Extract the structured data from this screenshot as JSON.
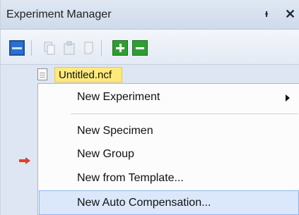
{
  "panel": {
    "title": "Experiment Manager",
    "pin_glyph": "ᵻ",
    "close_glyph": "✕"
  },
  "toolbar": {
    "icons": [
      "layout-icon",
      "copy-icon",
      "paste-icon",
      "delete-icon",
      "add-icon",
      "remove-icon"
    ]
  },
  "tree": {
    "node_label": "Untitled.ncf"
  },
  "context_menu": {
    "items": [
      {
        "label": "New Experiment",
        "has_submenu": true
      },
      {
        "label": "New Specimen"
      },
      {
        "label": "New Group"
      },
      {
        "label": "New from Template..."
      },
      {
        "label": "New Auto Compensation...",
        "highlighted": true
      }
    ]
  },
  "colors": {
    "accent_highlight": "#dbe8fb",
    "node_highlight": "#ffe97a",
    "add": "#2f9e32",
    "remove": "#2f9e32",
    "marker": "#e23c2d"
  }
}
